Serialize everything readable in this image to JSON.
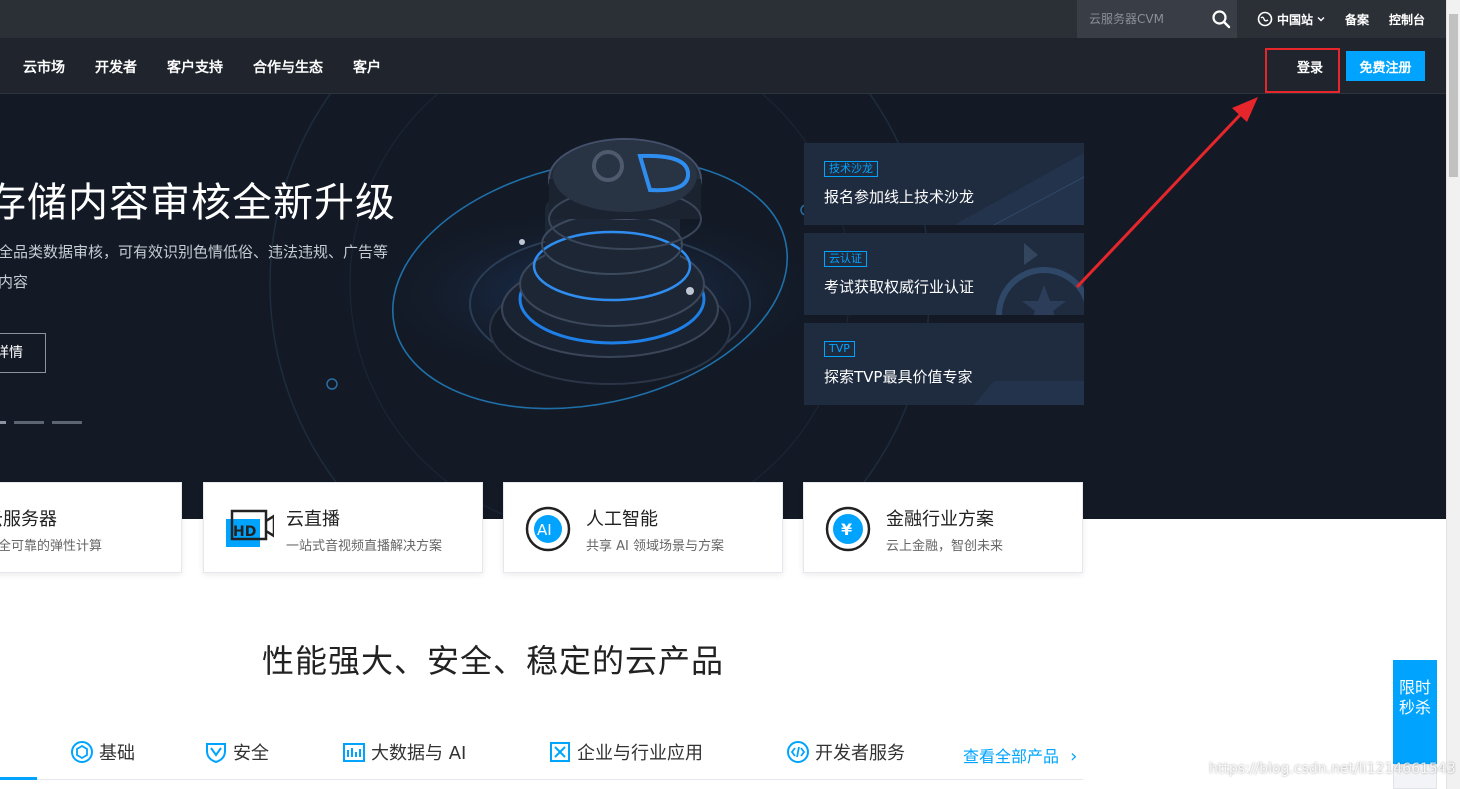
{
  "topbar": {
    "search_placeholder": "云服务器CVM",
    "site_switch": "中国站",
    "links": [
      "备案",
      "控制台"
    ]
  },
  "nav": {
    "items": [
      "云市场",
      "开发者",
      "客户支持",
      "合作与生态",
      "客户"
    ],
    "login": "登录",
    "register": "免费注册"
  },
  "hero": {
    "title": "存储内容审核全新升级",
    "description": "全品类数据审核，可有效识别色情低俗、违法违规、广告等内容",
    "button": "详情",
    "promos": [
      {
        "tag": "技术沙龙",
        "title": "报名参加线上技术沙龙"
      },
      {
        "tag": "云认证",
        "title": "考试获取权威行业认证"
      },
      {
        "tag": "TVP",
        "title": "探索TVP最具价值专家"
      }
    ]
  },
  "cards": [
    {
      "title": "云服务器",
      "desc": "安全可靠的弹性计算"
    },
    {
      "title": "云直播",
      "desc": "一站式音视频直播解决方案"
    },
    {
      "title": "人工智能",
      "desc": "共享 AI 领域场景与方案"
    },
    {
      "title": "金融行业方案",
      "desc": "云上金融，智创未来"
    }
  ],
  "section": {
    "title": "性能强大、安全、稳定的云产品"
  },
  "tabs": {
    "items": [
      "基础",
      "安全",
      "大数据与 AI",
      "企业与行业应用",
      "开发者服务"
    ],
    "view_all": "查看全部产品"
  },
  "flash_sale": "限时秒杀",
  "watermark": "https://blog.csdn.net/li1214661543",
  "colors": {
    "accent": "#00a4ff",
    "highlight": "#e6262b",
    "hero_bg": "#131a26"
  }
}
